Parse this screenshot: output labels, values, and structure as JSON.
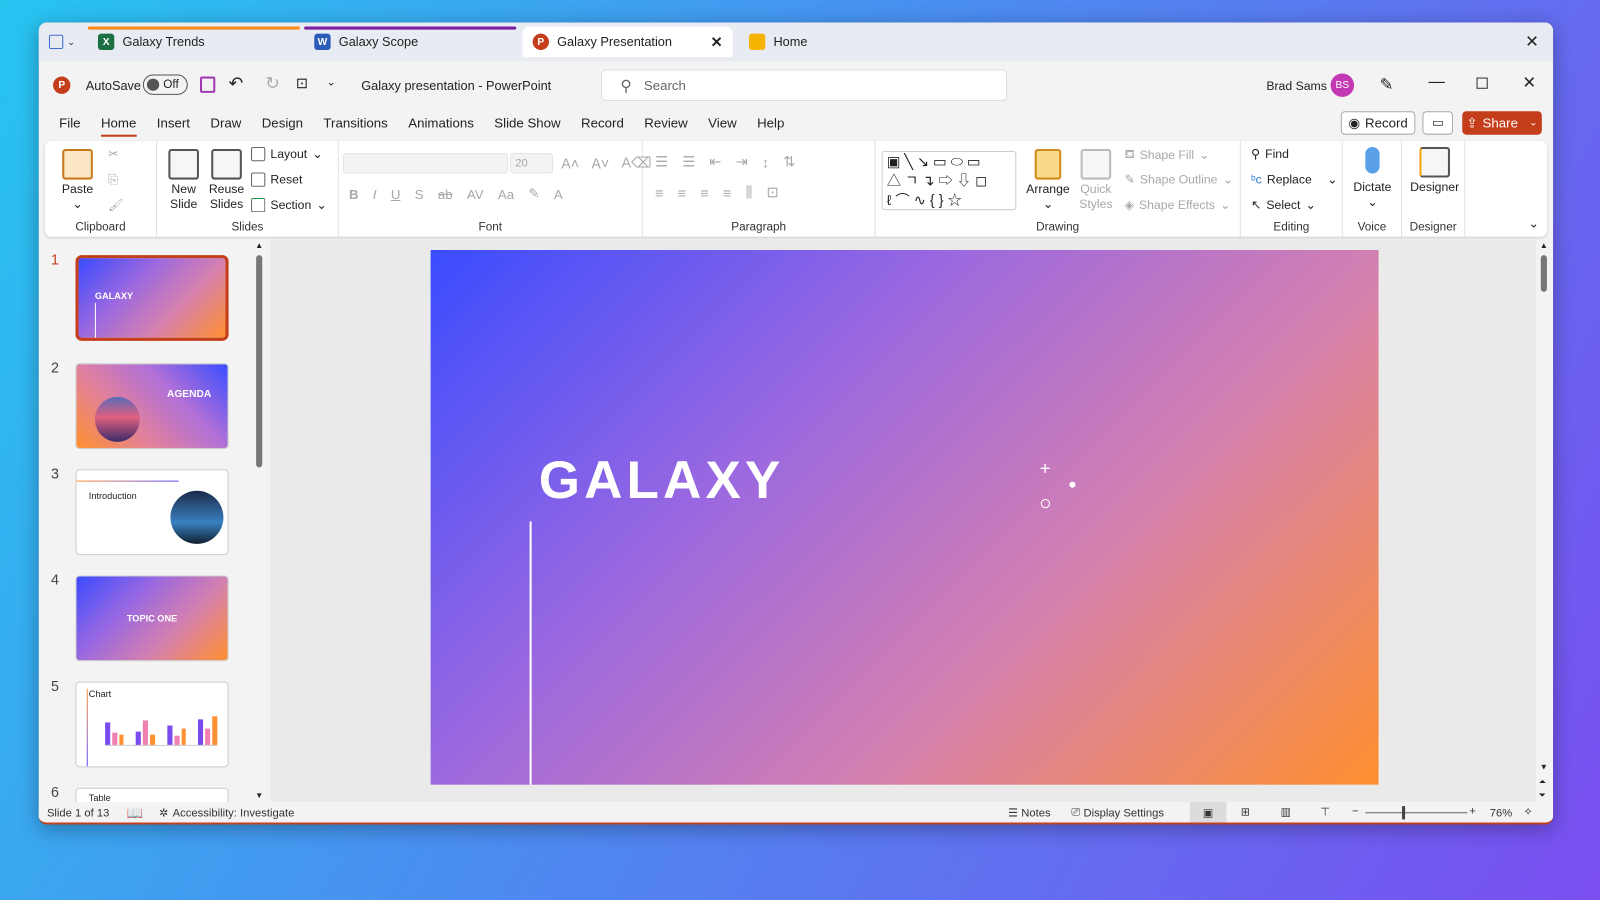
{
  "tabs": [
    {
      "label": "Galaxy Trends",
      "icon": "excel-icon",
      "color": "#ff8c1a"
    },
    {
      "label": "Galaxy Scope",
      "icon": "word-icon",
      "color": "#7a1fa2"
    },
    {
      "label": "Galaxy Presentation",
      "icon": "powerpoint-icon"
    },
    {
      "label": "Home",
      "icon": "folder-icon"
    }
  ],
  "titlebar": {
    "autosave": "AutoSave",
    "autosave_state": "Off",
    "doc_title": "Galaxy presentation  -  PowerPoint",
    "search_placeholder": "Search",
    "user": "Brad Sams",
    "initials": "BS"
  },
  "menu": [
    "File",
    "Home",
    "Insert",
    "Draw",
    "Design",
    "Transitions",
    "Animations",
    "Slide Show",
    "Record",
    "Review",
    "View",
    "Help"
  ],
  "actions": {
    "record": "Record",
    "share": "Share"
  },
  "ribbon": {
    "clipboard": {
      "label": "Clipboard",
      "paste": "Paste"
    },
    "slides": {
      "label": "Slides",
      "new_slide": [
        "New",
        "Slide"
      ],
      "reuse": [
        "Reuse",
        "Slides"
      ],
      "layout": "Layout",
      "reset": "Reset",
      "section": "Section"
    },
    "font": {
      "label": "Font",
      "size": "20"
    },
    "paragraph": {
      "label": "Paragraph"
    },
    "drawing": {
      "label": "Drawing",
      "arrange": "Arrange",
      "quick_styles": [
        "Quick",
        "Styles"
      ],
      "shape_fill": "Shape Fill",
      "shape_outline": "Shape Outline",
      "shape_effects": "Shape Effects"
    },
    "editing": {
      "label": "Editing",
      "find": "Find",
      "replace": "Replace",
      "select": "Select"
    },
    "voice": {
      "label": "Voice",
      "dictate": "Dictate"
    },
    "designer": {
      "label": "Designer",
      "designer": "Designer"
    }
  },
  "thumbnails": [
    {
      "num": "1",
      "title": "GALAXY"
    },
    {
      "num": "2",
      "title": "AGENDA"
    },
    {
      "num": "3",
      "title": "Introduction"
    },
    {
      "num": "4",
      "title": "TOPIC ONE"
    },
    {
      "num": "5",
      "title": "Chart"
    },
    {
      "num": "6",
      "title": "Table"
    }
  ],
  "slide": {
    "title": "GALAXY"
  },
  "status": {
    "slide": "Slide 1 of 13",
    "accessibility": "Accessibility: Investigate",
    "notes": "Notes",
    "display": "Display Settings",
    "zoom": "76%",
    "zoom_fraction": 0.5
  }
}
